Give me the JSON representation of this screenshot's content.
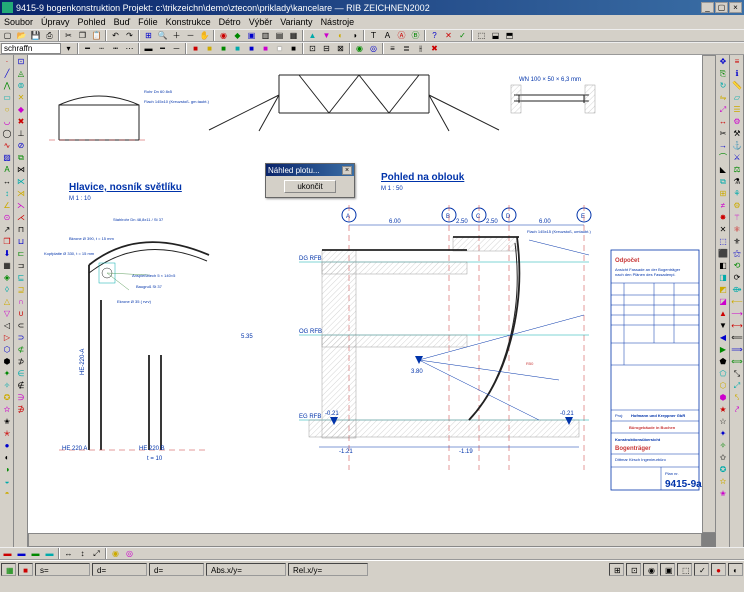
{
  "title": "9415-9 bogenkonstruktion   Projekt: c:\\trikzeichn\\demo\\ztecon\\priklady\\kancelare — RIB ZEICHNEN2002",
  "menu": {
    "m1": "Soubor",
    "m2": "Úpravy",
    "m3": "Pohled",
    "m4": "Buď",
    "m5": "Fólie",
    "m6": "Konstrukce",
    "m7": "Détro",
    "m8": "Výběr",
    "m9": "Varianty",
    "m10": "Nástroje"
  },
  "layer": "schraffn",
  "dialog": {
    "title": "Náhled plotu...",
    "button": "ukončit"
  },
  "drawing": {
    "title_left": "Hlavice, nosník světlíku",
    "scale_left": "M 1 : 10",
    "title_right": "Pohled na oblouk",
    "scale_right": "M 1 : 50",
    "section_A": "A",
    "section_B": "B",
    "section_C": "C",
    "section_D": "D",
    "section_E": "E",
    "dim_6_00a": "6.00",
    "dim_2_50a": "2.50",
    "dim_2_50b": "2.50",
    "dim_6_00b": "6.00",
    "label_flach": "Flach 145x15 (Kreuzstoß, umtaubt.)",
    "label_rohr": "Rohr Dn 60x2,8x11,2",
    "label_rohr2": "Rohr Dn 60 8x5",
    "lvl_dg": "DG RFB",
    "lvl_og": "OG RFB",
    "lvl_eg": "EG RFB",
    "elev_535": "5.35",
    "elev_380": "3.80",
    "elev_n021a": "-0.21",
    "elev_n021b": "-0.21",
    "dim_n121": "-1.21",
    "dim_n119": "-1.19",
    "label_he220a": "HE 220 A",
    "label_he220b": "HE 220 B",
    "label_t10": "t = 10",
    "label_stahl": "Stahlrohr Dn 48,8x11 / St 37",
    "label_bkrone": "Bkrone Ø 390, t = 15 mm",
    "label_kopf": "Kopfplatte Ø 330, t = 15 mm",
    "label_baugr": "Baugruß St 37",
    "label_anspie": "Anspießblech 5 × 140×5",
    "label_ekrone": "Ekrone Ø 35 ( rvrv)",
    "label_wl": "WN 100 × 50 × 6,3 mm",
    "label_flach2": "Flach 145x10 (Kreuzstoß. gm.taubt.)",
    "tb_odpocet": "Odpočet",
    "tb_sub": "Ansicht Fassade an der Bogenträger\nnach den Plänen des Fassadenplaners konstruiert",
    "tb_cust": "Hofmann und Kreppner GbR",
    "tb_proj": "Bürogebäude in Buchen",
    "tb_kons": "Konstruktionsübersicht",
    "tb_bogen": "Bogenträger",
    "tb_firm": "Dittmar Kirsch Ingenieurbüro",
    "tb_plan": "Plan nr.",
    "tb_num": "9415-9a"
  },
  "status": {
    "s1": "s=",
    "s2": "d=",
    "s3": "d=",
    "s4": "Abs.x/y=",
    "s5": "Rel.x/y="
  }
}
